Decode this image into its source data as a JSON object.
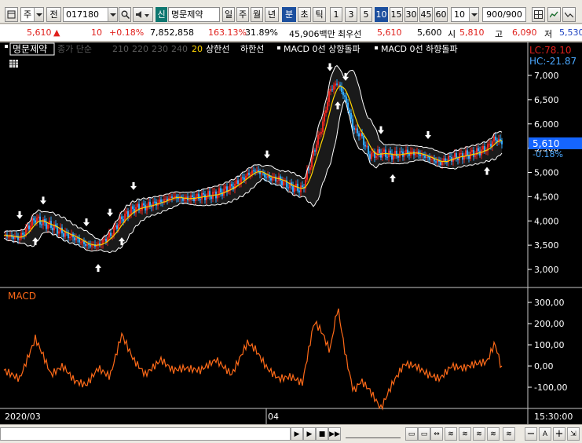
{
  "toolbar": {
    "market_label": "주",
    "prev_label": "전",
    "code_value": "017180",
    "credit_badge": "신",
    "stock_name": "명문제약",
    "periods": [
      "일",
      "주",
      "월",
      "년",
      "분",
      "초",
      "틱"
    ],
    "active_period": "분",
    "intervals": [
      "1",
      "3",
      "5",
      "10",
      "15",
      "30",
      "45",
      "60"
    ],
    "active_interval": "10",
    "interval_select": "10",
    "count_value": "900/900"
  },
  "quote": {
    "price": "5,610",
    "change_arrow": "▲",
    "change": "10",
    "change_pct": "+0.18%",
    "volume": "7,852,858",
    "volume_ratio": "163.13%",
    "turnover": "31.89%",
    "amount": "45,906백만",
    "best_ask_label": "최우선",
    "best_ask": "5,610",
    "best_bid": "5,600",
    "open_label": "시",
    "open": "5,810",
    "high_label": "고",
    "high": "6,090",
    "low_label": "저",
    "low": "5,530"
  },
  "legend": {
    "name": "명문제약",
    "ma_items": [
      "종가 단순",
      "210",
      "220",
      "230",
      "240"
    ],
    "ma_20": "20",
    "upper_band": "상한선",
    "lower_band": "하한선",
    "macd_up": "MACD 0선 상향돌파",
    "macd_down": "MACD 0선 하향돌파"
  },
  "price_panel": {
    "lc_label": "LC:78.10",
    "hc_label": "HC:-21.87",
    "current_price": "5,610",
    "current_change": "-0.18%",
    "y_ticks": [
      "7,000",
      "6,500",
      "6,000",
      "5,500",
      "5,000",
      "4,500",
      "4,000",
      "3,500",
      "3,000"
    ]
  },
  "macd_panel": {
    "title": "MACD",
    "y_ticks": [
      "300,00",
      "200,00",
      "100,00",
      "0,00",
      "-100,00"
    ]
  },
  "x_axis": {
    "start_label": "2020/03",
    "mid_label": "04",
    "time_label": "15:30:00"
  },
  "colors": {
    "chart_bg": "#000000",
    "up_candle": "#e8261f",
    "down_candle": "#30a8ff",
    "ma_line": "#ffd400",
    "band_line": "#ffffff",
    "macd_line": "#ff6a18",
    "buy_signal": "#ffffff",
    "axis_text": "#ffffff"
  },
  "chart_data": {
    "type": "line",
    "price_series": {
      "name": "",
      "x": [
        0,
        20,
        40,
        50,
        60,
        75,
        90,
        105,
        120,
        135,
        150,
        165,
        180,
        200,
        215,
        230,
        250,
        270,
        290,
        310,
        320,
        335,
        350,
        365,
        380,
        395,
        405,
        415,
        425,
        435,
        445,
        455,
        465,
        480,
        495,
        510,
        525,
        540,
        555,
        570,
        585,
        600,
        615,
        625,
        635
      ],
      "values": [
        3700,
        3650,
        4050,
        3950,
        3900,
        3750,
        3650,
        3500,
        3500,
        3700,
        4050,
        4250,
        4300,
        4400,
        4500,
        4450,
        4500,
        4550,
        4700,
        4950,
        5050,
        4900,
        4850,
        4700,
        4650,
        5450,
        5950,
        6700,
        6850,
        6500,
        5900,
        5750,
        5350,
        5400,
        5350,
        5400,
        5400,
        5300,
        5200,
        5300,
        5350,
        5400,
        5500,
        5700,
        5610
      ]
    },
    "macd_series": {
      "name": "MACD",
      "x": [
        0,
        20,
        40,
        50,
        60,
        75,
        90,
        105,
        120,
        135,
        150,
        165,
        180,
        200,
        215,
        230,
        250,
        270,
        290,
        310,
        320,
        335,
        350,
        365,
        380,
        395,
        405,
        415,
        425,
        435,
        445,
        455,
        465,
        480,
        495,
        510,
        525,
        540,
        555,
        570,
        585,
        600,
        615,
        625,
        635
      ],
      "values": [
        -20,
        -60,
        130,
        50,
        -40,
        0,
        -70,
        -90,
        -10,
        -50,
        150,
        30,
        -40,
        30,
        -20,
        -10,
        -20,
        30,
        -40,
        110,
        80,
        -10,
        -60,
        -50,
        -80,
        210,
        160,
        70,
        280,
        50,
        -120,
        -70,
        -110,
        -200,
        -80,
        10,
        0,
        -40,
        -60,
        0,
        -10,
        10,
        20,
        110,
        -30
      ]
    },
    "y_range_price": [
      3000,
      7000
    ],
    "y_range_macd": [
      -100,
      300
    ],
    "xlabel": "",
    "ylabel": ""
  }
}
